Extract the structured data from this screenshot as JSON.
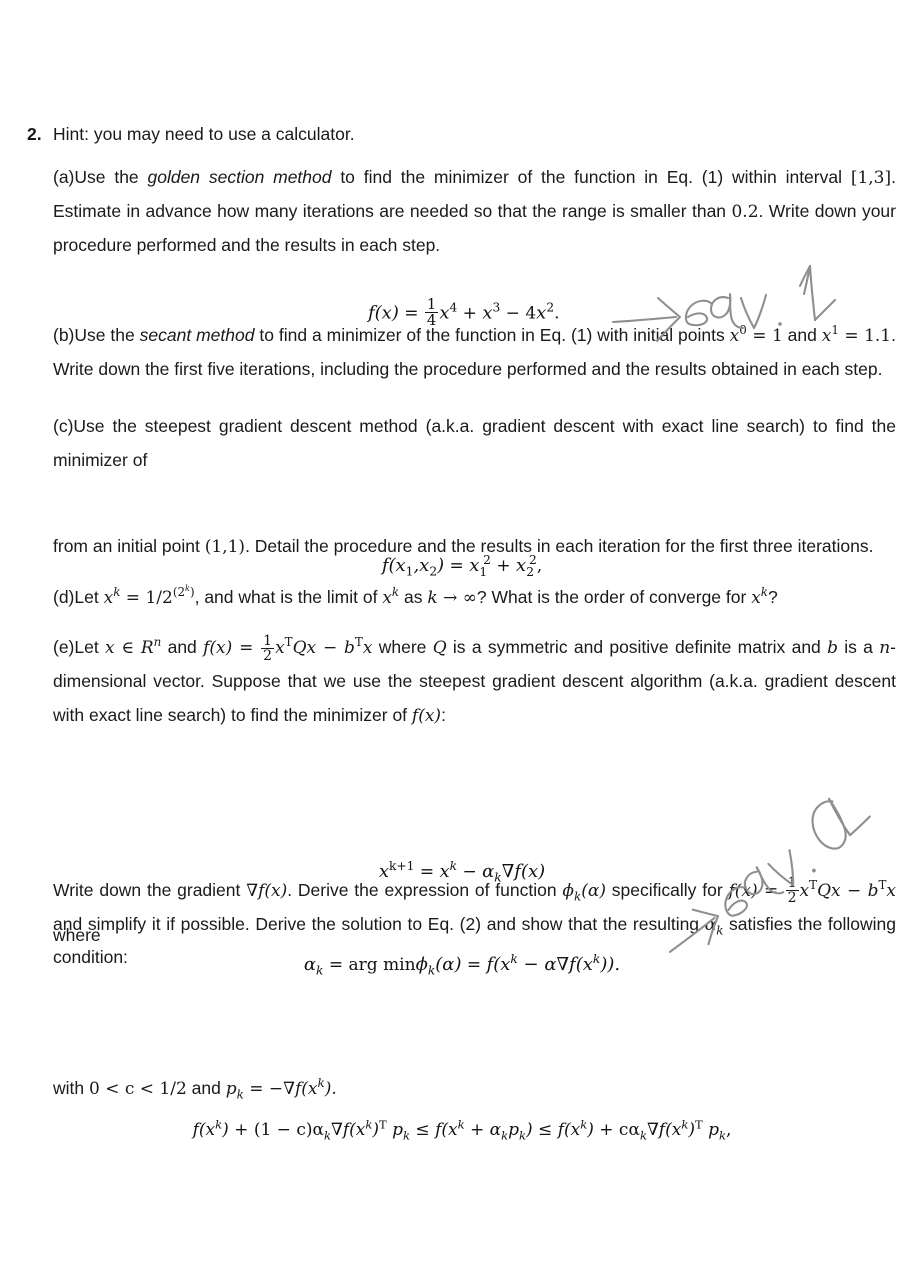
{
  "document": {
    "type": "textbook-exercise",
    "background_color": "#ffffff",
    "text_color": "#1a1a1a",
    "ink_color": "#8a8a8a"
  },
  "problem": {
    "number": "2.",
    "hint": "Hint: you may need to use a calculator."
  },
  "parts": {
    "a": {
      "label": "(a)",
      "text_1": "Use the ",
      "emph_1": "golden section method",
      "text_2": " to find the minimizer of the function in Eq. (1) within interval ",
      "math_interval": "[1,3]",
      "text_3": ". Estimate in advance how many iterations are needed so that the range is smaller than ",
      "math_tol": "0.2",
      "text_4": ". Write down your procedure performed and the results in each step."
    },
    "b": {
      "label": "(b)",
      "text_1": "Use the ",
      "emph_1": "secant method",
      "text_2": " to find a minimizer of the function in Eq. (1) with initial points ",
      "math_x0": "x",
      "math_x0_sup": "0",
      "math_x0_val": " = 1",
      "text_3": " and ",
      "math_x1": "x",
      "math_x1_sup": "1",
      "math_x1_val": " = 1.1",
      "text_4": ". Write down the first five iterations, including the procedure performed and the results obtained in each step."
    },
    "c": {
      "label": "(c)",
      "text_1": "Use the steepest gradient descent method (a.k.a. gradient descent with exact line search) to find the minimizer of",
      "text_2": "from an initial point ",
      "math_point": "(1,1)",
      "text_3": ". Detail the procedure and the results in each iteration for the first three iterations."
    },
    "d": {
      "label": "(d)",
      "text_1": "Let ",
      "math_xk": "x",
      "math_xk_sup": "k",
      "math_eq": " = 1/2",
      "math_exp": "(2",
      "math_exp_sup": "k",
      "math_exp_close": ")",
      "text_2": ", and what is the limit of ",
      "math_xk2": "x",
      "math_xk2_sup": "k",
      "text_3": " as ",
      "math_k": "k",
      "math_arrow": " → ∞",
      "text_4": "? What is the order of converge for ",
      "math_xk3": "x",
      "math_xk3_sup": "k",
      "text_5": "?"
    },
    "e": {
      "label": "(e)",
      "text_1": "Let ",
      "math_x_in": "x ∈ R",
      "math_n_sup": "n",
      "text_2": " and ",
      "math_f": "f(x)",
      "math_eq": " = ",
      "math_quad_num": "1",
      "math_quad_den": "2",
      "math_quad": "x",
      "math_quad_T": "T",
      "math_quad_Q": "Qx − b",
      "math_quad_T2": "T",
      "math_quad_x": "x",
      "text_3": " where ",
      "math_Q": "Q",
      "text_4": " is a symmetric and positive definite matrix and ",
      "math_b": "b",
      "text_5": " is a ",
      "math_n": "n",
      "text_6": "-dimensional vector. Suppose that we use the steepest gradient descent algorithm (a.k.a. gradient descent with exact line search) to find the minimizer of ",
      "math_fx": "f(x)",
      "text_7": ":"
    },
    "where": "where",
    "final": {
      "text_1": "Write down the gradient ",
      "math_grad": "∇f(x)",
      "text_2": ". Derive the expression of function ",
      "math_phi": "ϕ",
      "math_phi_sub": "k",
      "math_phi_arg": "(α)",
      "text_3": " specifically for ",
      "math_fx": "f(x)",
      "math_eq": " = ",
      "math_quad_num": "1",
      "math_quad_den": "2",
      "math_quad": "x",
      "math_quad_T": "T",
      "math_quad_rest": "Qx − b",
      "math_quad_T2": "T",
      "math_quad_x": "x",
      "text_4": " and simplify it if possible. Derive the solution to Eq. (2) and show that the resulting ",
      "math_alpha": "α",
      "math_alpha_sub": "k",
      "text_5": " satisfies the following condition:"
    },
    "closing": {
      "text_1": "with ",
      "math_c": "0 < c < 1/2",
      "text_2": " and ",
      "math_pk": "p",
      "math_pk_sub": "k",
      "math_pk_eq": " = −∇f(x",
      "math_pk_sup": "k",
      "math_pk_close": ")."
    }
  },
  "equations": {
    "eq1": {
      "lhs": "f(x)",
      "eq": " = ",
      "frac_num": "1",
      "frac_den": "4",
      "term1": "x",
      "term1_sup": "4",
      "plus": " + ",
      "term2": "x",
      "term2_sup": "3",
      "minus": " − 4",
      "term3": "x",
      "term3_sup": "2",
      "period": "."
    },
    "eq_c": {
      "lhs": "f(x",
      "lhs_sub1": "1",
      "lhs_mid": ",x",
      "lhs_sub2": "2",
      "lhs_close": ")",
      "eq": " = ",
      "t1": "x",
      "t1_sub": "1",
      "t1_sup": "2",
      "plus": " + ",
      "t2": "x",
      "t2_sub": "2",
      "t2_sup": "2",
      "comma": ","
    },
    "eq_update": {
      "lhs": "x",
      "lhs_sup": "k+1",
      "eq": " = ",
      "rhs1": "x",
      "rhs1_sup": "k",
      "minus": " − ",
      "alpha": "α",
      "alpha_sub": "k",
      "grad": "∇f(x)"
    },
    "eq_alpha": {
      "lhs": "α",
      "lhs_sub": "k",
      "eq": " = ",
      "argmin": "arg min",
      "phi": "ϕ",
      "phi_sub": "k",
      "phi_arg": "(α)",
      "eq2": " = ",
      "rhs": "f(x",
      "rhs_sup": "k",
      "rhs_mid": " − α∇f(x",
      "rhs_sup2": "k",
      "rhs_close": "))."
    },
    "eq_goldstein": {
      "p1": "f(x",
      "p1_sup": "k",
      "p1_close": ")",
      "p2": " + (1 − c)α",
      "p2_sub": "k",
      "p2_grad": "∇f(x",
      "p2_sup": "k",
      "p2_closeT": ")",
      "p2_T": "T",
      "p2_p": " p",
      "p2_psub": "k",
      "le1": " ≤ ",
      "p3": "f(x",
      "p3_sup": "k",
      "p3_mid": " + α",
      "p3_sub": "k",
      "p3_p": "p",
      "p3_psub": "k",
      "p3_close": ")",
      "le2": " ≤ ",
      "p4": "f(x",
      "p4_sup": "k",
      "p4_close": ")",
      "p5": " + cα",
      "p5_sub": "k",
      "p5_grad": "∇f(x",
      "p5_sup": "k",
      "p5_closeT": ")",
      "p5_T": "T",
      "p5_p": " p",
      "p5_psub": "k",
      "comma": ","
    }
  },
  "annotations": [
    {
      "name": "handwritten-eq1-note",
      "text": "→ eqv. 1",
      "description": "handwritten pen arrow pointing to equation one label"
    },
    {
      "name": "handwritten-eq2-note",
      "text": "→ eqv. 2",
      "description": "handwritten pen arrow pointing to equation two label, rotated"
    }
  ]
}
